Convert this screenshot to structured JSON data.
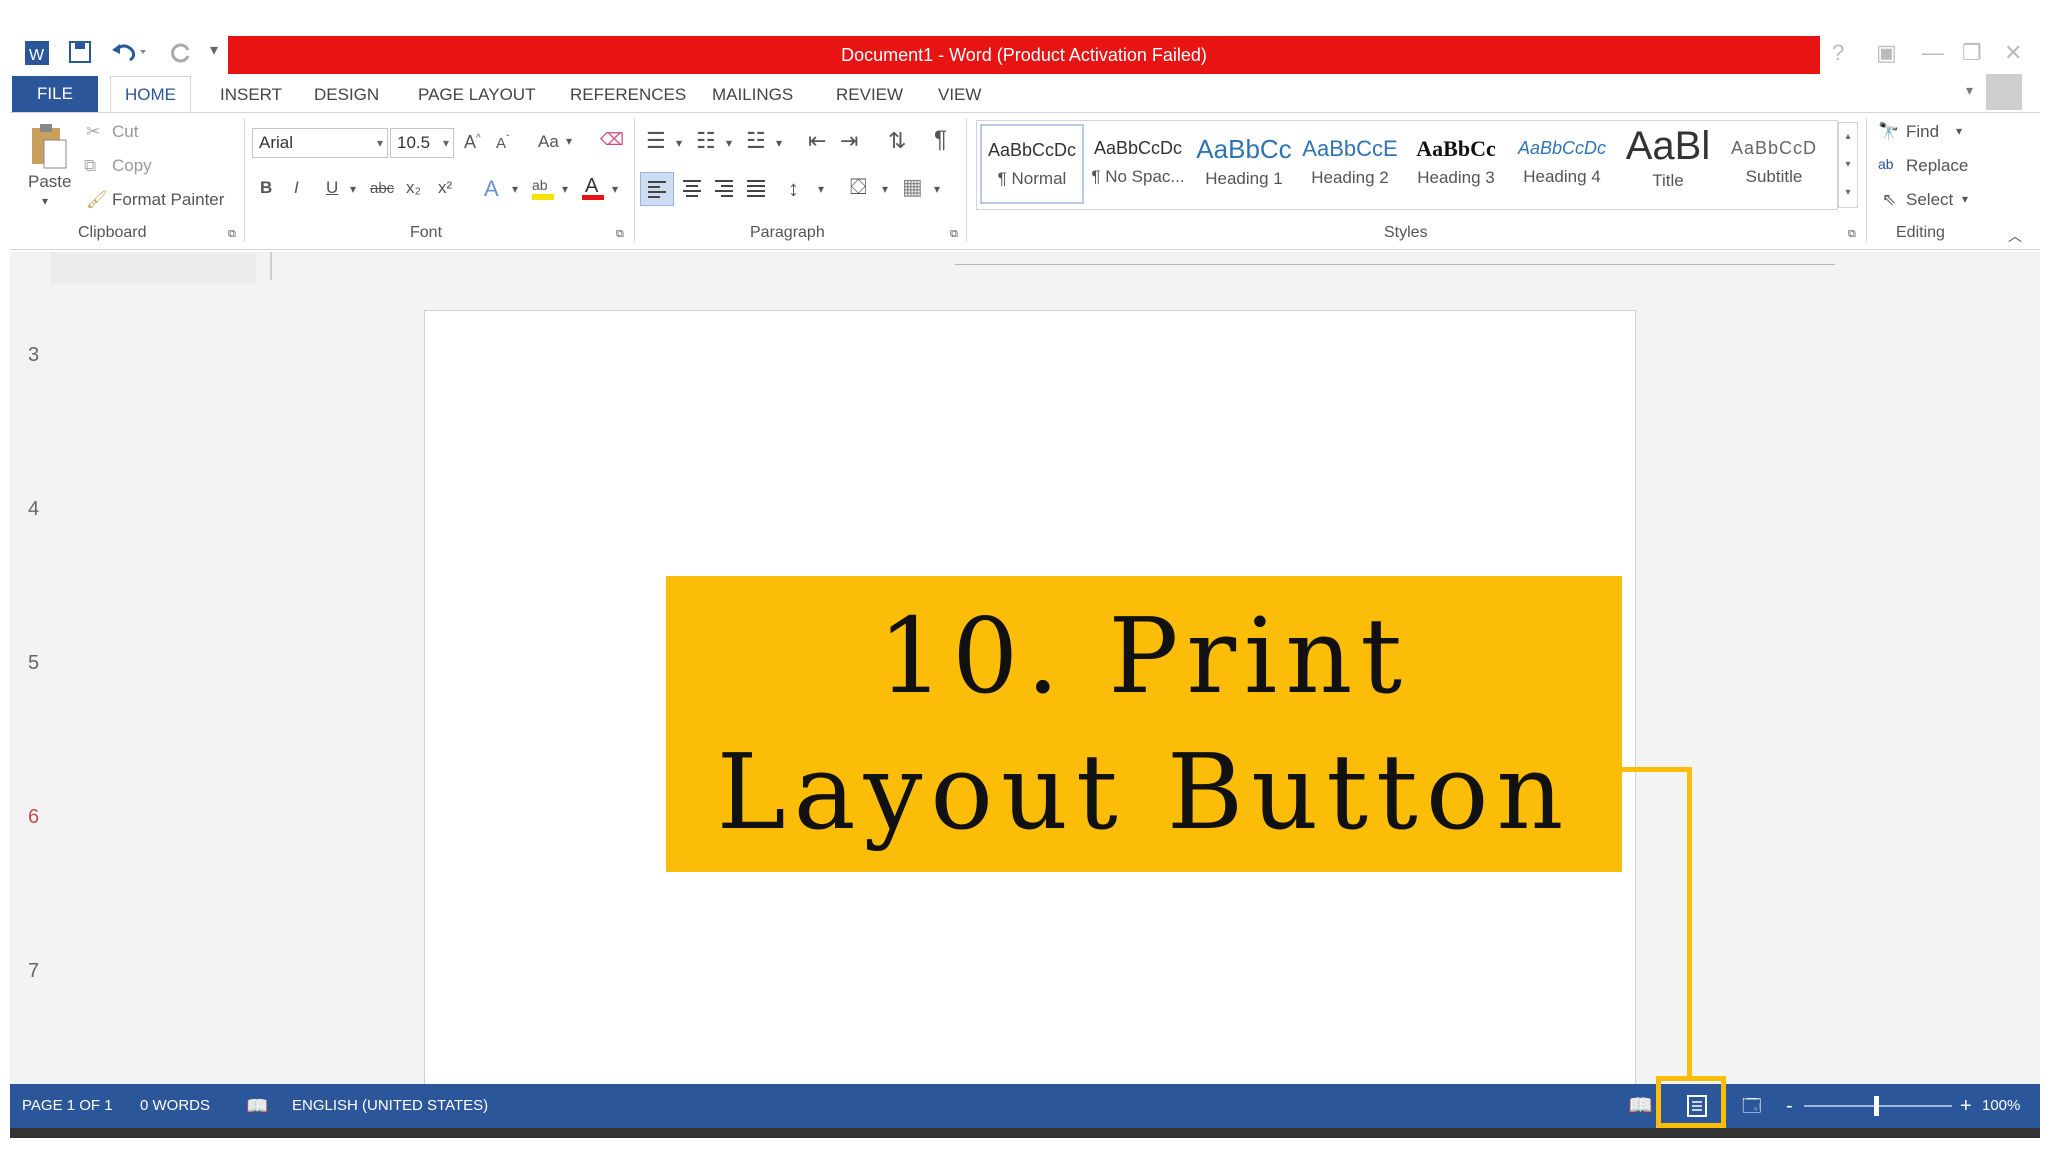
{
  "window": {
    "title": "Document1 -  Word (Product Activation Failed)",
    "accent_color": "#2b579a",
    "title_bar_color": "#e81414",
    "help_label": "?"
  },
  "quick_access": {
    "icons": [
      "word-logo-icon",
      "save-icon",
      "undo-icon",
      "redo-icon",
      "customize-icon"
    ]
  },
  "tabs": [
    "FILE",
    "HOME",
    "INSERT",
    "DESIGN",
    "PAGE LAYOUT",
    "REFERENCES",
    "MAILINGS",
    "REVIEW",
    "VIEW"
  ],
  "clipboard": {
    "paste": "Paste",
    "cut": "Cut",
    "copy": "Copy",
    "format_painter": "Format Painter",
    "label": "Clipboard"
  },
  "font": {
    "family": "Arial",
    "size": "10.5",
    "case_label": "Aa",
    "bold": "B",
    "italic": "I",
    "underline": "U",
    "strikethrough": "abc",
    "subscript": "x₂",
    "superscript": "x²",
    "label": "Font"
  },
  "paragraph": {
    "label": "Paragraph",
    "pilcrow": "¶"
  },
  "styles": {
    "label": "Styles",
    "items": [
      {
        "sample": "AaBbCcDc",
        "name": "¶ Normal"
      },
      {
        "sample": "AaBbCcDc",
        "name": "¶ No Spac..."
      },
      {
        "sample": "AaBbCc",
        "name": "Heading 1"
      },
      {
        "sample": "AaBbCcE",
        "name": "Heading 2"
      },
      {
        "sample": "AaBbCc",
        "name": "Heading 3"
      },
      {
        "sample": "AaBbCcDc",
        "name": "Heading 4"
      },
      {
        "sample": "AaBl",
        "name": "Title"
      },
      {
        "sample": "AaBbCcD",
        "name": "Subtitle"
      }
    ]
  },
  "editing": {
    "find": "Find",
    "replace": "Replace",
    "select": "Select",
    "label": "Editing"
  },
  "document": {
    "row_numbers": [
      "3",
      "4",
      "5",
      "6",
      "7"
    ]
  },
  "status": {
    "page": "PAGE 1 OF 1",
    "words": "0 WORDS",
    "language": "ENGLISH (UNITED STATES)",
    "zoom": "100%",
    "zoom_minus": "-",
    "zoom_plus": "+"
  },
  "callout": {
    "text": "10. Print Layout Button",
    "color": "#fbbd08"
  }
}
